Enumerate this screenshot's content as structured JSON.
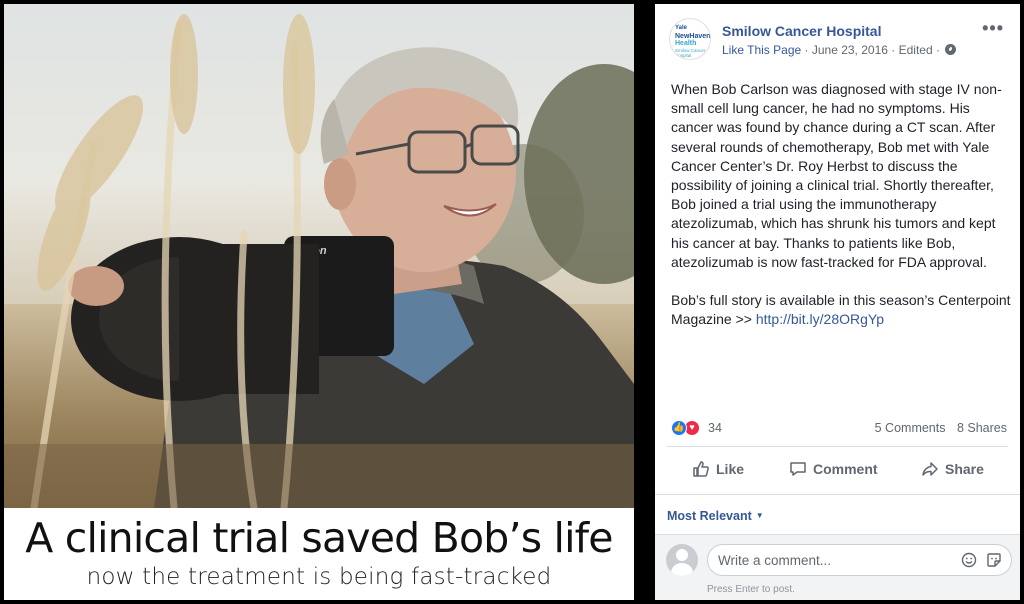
{
  "photo": {
    "caption_title": "A clinical trial saved Bob’s life",
    "caption_subtitle": "now the treatment is being fast-tracked",
    "camera_brand": "Nikon"
  },
  "post": {
    "page_avatar_lines": [
      "Yale",
      "NewHaven",
      "Health",
      "Smilow Cancer Hospital"
    ],
    "page_name": "Smilow Cancer Hospital",
    "like_page": "Like This Page",
    "separator": " · ",
    "date": "June 23, 2016",
    "edited": "Edited",
    "more_icon": "more-options-icon",
    "body_text": "When Bob Carlson was diagnosed with stage IV non-small cell lung cancer, he had no symptoms. His cancer was found by chance during a CT scan. After several rounds of chemotherapy, Bob met with Yale Cancer Center’s Dr. Roy Herbst to discuss the possibility of joining a clinical trial. Shortly thereafter, Bob joined a trial using the immunotherapy atezolizumab, which has shrunk his tumors and kept his cancer at bay. Thanks to patients like Bob, atezolizumab is now fast-tracked for FDA approval.\n\nBob’s full story is available in this season’s Centerpoint Magazine >> ",
    "body_link": "http://bit.ly/28ORgYp"
  },
  "reactions": {
    "count": "34",
    "comments": "5 Comments",
    "shares": "8 Shares",
    "like_color": "#1877f2",
    "love_color": "#f0284a"
  },
  "actions": {
    "like": "Like",
    "comment": "Comment",
    "share": "Share"
  },
  "comments": {
    "sort_label": "Most Relevant",
    "placeholder": "Write a comment...",
    "press_enter": "Press Enter to post."
  },
  "colors": {
    "link": "#365899",
    "meta": "#616770",
    "text": "#1d2129"
  }
}
